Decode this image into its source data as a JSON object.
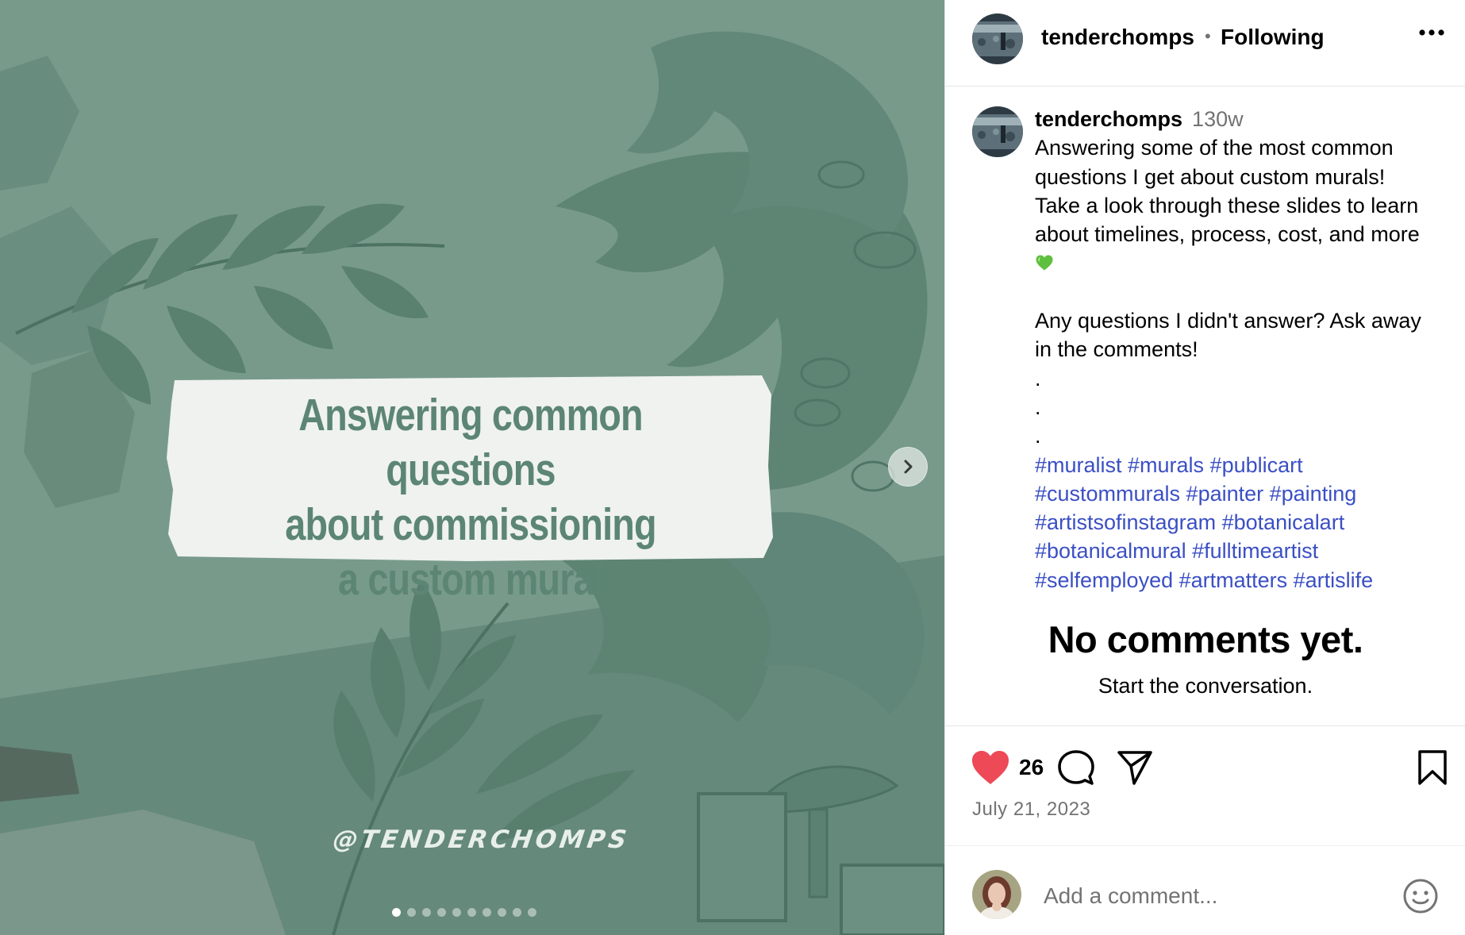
{
  "media": {
    "card_lines": [
      "Answering common questions",
      "about commissioning",
      "a custom mural"
    ],
    "watermark": "@TENDERCHOMPS",
    "slide_count": 10,
    "active_slide": 1
  },
  "header": {
    "username": "tenderchomps",
    "separator": "•",
    "follow_status": "Following"
  },
  "post": {
    "username": "tenderchomps",
    "time_ago": "130w",
    "caption_lines": [
      "Answering some of the most common",
      "questions I get about custom murals!",
      "Take a look through these slides to learn",
      "about timelines, process, cost, and more"
    ],
    "emoji": "green-heart",
    "caption2_lines": [
      "Any questions I didn't answer? Ask away",
      "in the comments!"
    ],
    "dot_lines": [
      ".",
      ".",
      "."
    ],
    "hashtag_lines": [
      "#muralist #murals #publicart",
      "#custommurals #painter #painting",
      "#artistsofinstagram #botanicalart",
      "#botanicalmural #fulltimeartist",
      "#selfemployed #artmatters #artislife"
    ]
  },
  "comments": {
    "empty_title": "No comments yet.",
    "empty_subtitle": "Start the conversation."
  },
  "actions": {
    "likes": "26",
    "date": "July 21, 2023",
    "like_color": "#ed4956"
  },
  "comment_box": {
    "placeholder": "Add a comment..."
  },
  "colors": {
    "hashtag": "#3b4fc4",
    "media_bg": "#6f9283",
    "card_text": "#5c8574"
  }
}
